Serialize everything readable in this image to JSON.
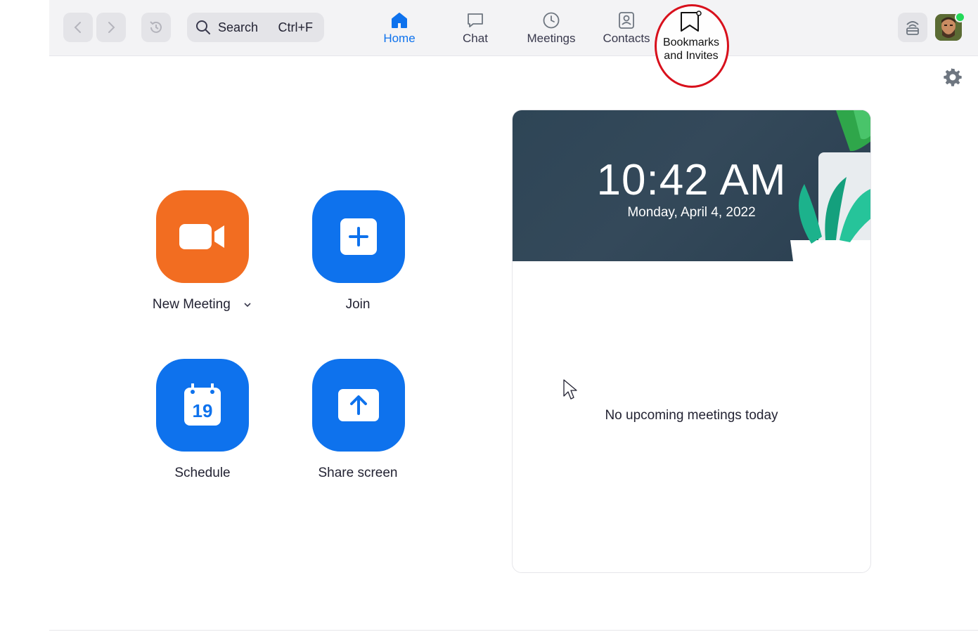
{
  "toolbar": {
    "search_label": "Search",
    "search_shortcut": "Ctrl+F"
  },
  "tabs": [
    {
      "label": "Home",
      "icon": "home-icon",
      "active": true
    },
    {
      "label": "Chat",
      "icon": "chat-bubble-icon",
      "active": false
    },
    {
      "label": "Meetings",
      "icon": "clock-icon",
      "active": false
    },
    {
      "label": "Contacts",
      "icon": "contact-card-icon",
      "active": false
    },
    {
      "label": "Bookmarks and Invites",
      "icon": "bookmark-icon",
      "active": false,
      "highlighted": true
    }
  ],
  "actions": {
    "new_meeting": {
      "label": "New Meeting",
      "icon": "video-camera-icon",
      "color": "#f26d21"
    },
    "join": {
      "label": "Join",
      "icon": "plus-icon",
      "color": "#0e72ed"
    },
    "schedule": {
      "label": "Schedule",
      "icon": "calendar-icon",
      "calendar_day": "19",
      "color": "#0e72ed"
    },
    "share_screen": {
      "label": "Share screen",
      "icon": "upload-arrow-icon",
      "color": "#0e72ed"
    }
  },
  "card": {
    "time": "10:42 AM",
    "date": "Monday, April 4, 2022",
    "empty_message": "No upcoming meetings today"
  },
  "colors": {
    "accent": "#0e72ed",
    "orange": "#f26d21",
    "highlight_ring": "#d8101c",
    "presence": "#23d959"
  }
}
